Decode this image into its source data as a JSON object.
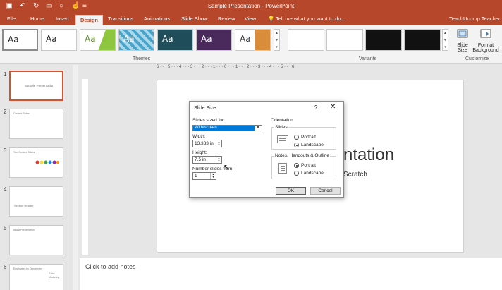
{
  "window": {
    "title": "Sample Presentation - PowerPoint",
    "user": "TeachUcomp Teacher"
  },
  "tabs": [
    "File",
    "Home",
    "Insert",
    "Design",
    "Transitions",
    "Animations",
    "Slide Show",
    "Review",
    "View"
  ],
  "active_tab": "Design",
  "tell_me": "Tell me what you want to do...",
  "ribbon": {
    "themes_label": "Themes",
    "variants_label": "Variants",
    "customize_label": "Customize",
    "theme_sample": "Aa",
    "slide_size_label": "Slide",
    "slide_size_label2": "Size",
    "format_bg_label": "Format",
    "format_bg_label2": "Background"
  },
  "thumbnails": {
    "numbers": [
      "1",
      "2",
      "3",
      "4",
      "5",
      "6"
    ],
    "slide1_title": "Sample Presentation",
    "slide2_title": "Content Slides",
    "slide3_title": "Two Content Slides",
    "slide4_title": "Section Header",
    "slide5_title": "About Presentation",
    "slide6_title": "Employees by Department",
    "slide6_row1": "Sales",
    "slide6_row2": "Marketing"
  },
  "ruler": {
    "h": "6 · · · 5 · · · 4 · · · 3 · · · 2 · · · 1 · · · 0 · · · 1 · · · 2 · · · 3 · · · 4 · · · 5 · · · 6"
  },
  "slide": {
    "title_fragment": "ntation",
    "subtitle_fragment": "Scratch"
  },
  "notes_placeholder": "Click to add notes",
  "dialog": {
    "title": "Slide Size",
    "help": "?",
    "close": "✕",
    "sized_for_label": "Slides sized for:",
    "sized_for_value": "Widescreen",
    "width_label": "Width:",
    "width_value": "13.333 in",
    "height_label": "Height:",
    "height_value": "7.5 in",
    "number_from_label": "Number slides from:",
    "number_from_value": "1",
    "orientation_label": "Orientation",
    "slides_label": "Slides",
    "portrait_label": "Portrait",
    "landscape_label": "Landscape",
    "notes_label": "Notes, Handouts & Outline",
    "notes_portrait_label": "Portrait",
    "notes_landscape_label": "Landscape",
    "ok_label": "OK",
    "cancel_label": "Cancel"
  },
  "colors": {
    "accent": "#b7472a",
    "dialog_select": "#0078d7"
  }
}
